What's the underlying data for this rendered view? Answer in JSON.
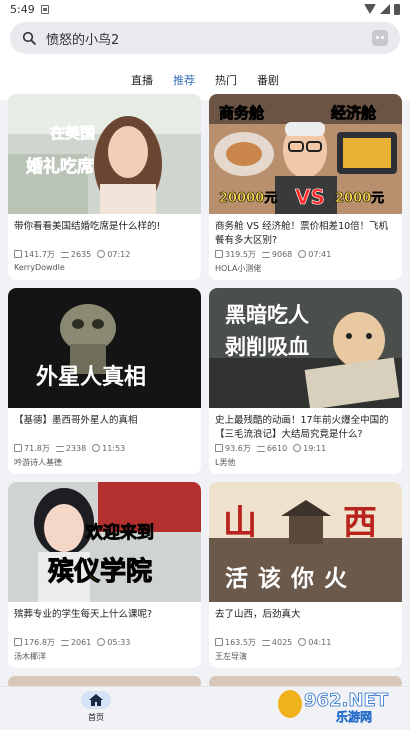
{
  "status_bar": {
    "time": "5:49",
    "notification_icon": "a-square-icon"
  },
  "search": {
    "text": "愤怒的小鸟2"
  },
  "tabs": [
    {
      "label": "直播",
      "active": false
    },
    {
      "label": "推荐",
      "active": true
    },
    {
      "label": "热门",
      "active": false
    },
    {
      "label": "番剧",
      "active": false
    }
  ],
  "cards": [
    {
      "thumb_text": [
        "在美国",
        "婚礼吃席"
      ],
      "title": "带你看看美国结婚吃席是什么样的!",
      "views": "141.7万",
      "danmaku": "2635",
      "duration": "07:12",
      "author": "KerryDowdle"
    },
    {
      "thumb_text": [
        "商务舱",
        "经济舱",
        "20000元",
        "VS",
        "2000元"
      ],
      "title": "商务舱 VS 经济舱！票价相差10倍！飞机餐有多大区别?",
      "views": "319.5万",
      "danmaku": "9068",
      "duration": "07:41",
      "author": "HOLA小测佬"
    },
    {
      "thumb_text": [
        "外星人真相"
      ],
      "title": "【基德】墨西哥外星人的真相",
      "views": "71.8万",
      "danmaku": "2338",
      "duration": "11:53",
      "author": "吟游诗人基德"
    },
    {
      "thumb_text": [
        "黑暗吃人",
        "剥削吸血"
      ],
      "title": "史上最残酷的动画！17年前火爆全中国的【三毛流浪记】大结局究竟是什么?",
      "views": "93.6万",
      "danmaku": "6610",
      "duration": "19:11",
      "author": "L男他"
    },
    {
      "thumb_text": [
        "欢迎来到",
        "殡仪学院"
      ],
      "title": "殡葬专业的学生每天上什么课呢?",
      "views": "176.8万",
      "danmaku": "2061",
      "duration": "05:33",
      "author": "汤木椰洋"
    },
    {
      "thumb_text": [
        "山",
        "西",
        "活该你火"
      ],
      "title": "去了山西，后劲真大",
      "views": "163.5万",
      "danmaku": "4025",
      "duration": "04:11",
      "author": "王左导演"
    }
  ],
  "bottom_nav": {
    "home_label": "首页"
  },
  "watermark": {
    "text": "962.NET",
    "sub": "乐游网"
  },
  "colors": {
    "accent": "#3c6fb5",
    "nav_pill": "#d5e3f6"
  }
}
